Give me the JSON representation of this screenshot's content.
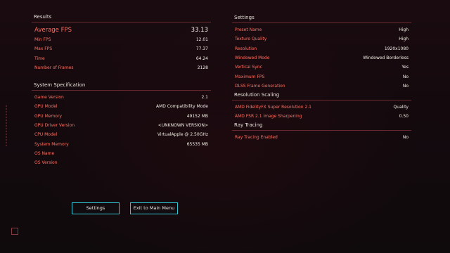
{
  "results": {
    "title": "Results",
    "rows": [
      {
        "label": "Average FPS",
        "value": "33.13"
      },
      {
        "label": "Min FPS",
        "value": "12.01"
      },
      {
        "label": "Max FPS",
        "value": "77.37"
      },
      {
        "label": "Time",
        "value": "64.24"
      },
      {
        "label": "Number of Frames",
        "value": "2128"
      }
    ]
  },
  "system": {
    "title": "System Specification",
    "rows": [
      {
        "label": "Game Version",
        "value": "2.1"
      },
      {
        "label": "GPU Model",
        "value": "AMD Compatibility Mode"
      },
      {
        "label": "GPU Memory",
        "value": "49152 MB"
      },
      {
        "label": "GPU Driver Version",
        "value": "<UNKNOWN VERSION>"
      },
      {
        "label": "CPU Model",
        "value": "VirtualApple @ 2.50GHz"
      },
      {
        "label": "System Memory",
        "value": "65535 MB"
      },
      {
        "label": "OS Name",
        "value": ""
      },
      {
        "label": "OS Version",
        "value": ""
      }
    ]
  },
  "settings": {
    "title": "Settings",
    "rows": [
      {
        "label": "Preset Name",
        "value": "High"
      },
      {
        "label": "Texture Quality",
        "value": "High"
      },
      {
        "label": "Resolution",
        "value": "1920x1080"
      },
      {
        "label": "Windowed Mode",
        "value": "Windowed Borderless"
      },
      {
        "label": "Vertical Sync",
        "value": "Yes"
      },
      {
        "label": "Maximum FPS",
        "value": "No"
      },
      {
        "label": "DLSS Frame Generation",
        "value": "No"
      }
    ]
  },
  "scaling": {
    "title": "Resolution Scaling",
    "rows": [
      {
        "label": "AMD FidelityFX Super Resolution 2.1",
        "value": "Quality"
      },
      {
        "label": "AMD FSR 2.1 Image Sharpening",
        "value": "0.50"
      }
    ]
  },
  "raytracing": {
    "title": "Ray Tracing",
    "rows": [
      {
        "label": "Ray Tracing Enabled",
        "value": "No"
      }
    ]
  },
  "buttons": {
    "settings": "Settings",
    "exit": "Exit to Main Menu"
  },
  "colors": {
    "label": "#ff6f61",
    "value": "#f3eee6",
    "accent": "#30c7d6",
    "divider": "#6b2a2f"
  }
}
